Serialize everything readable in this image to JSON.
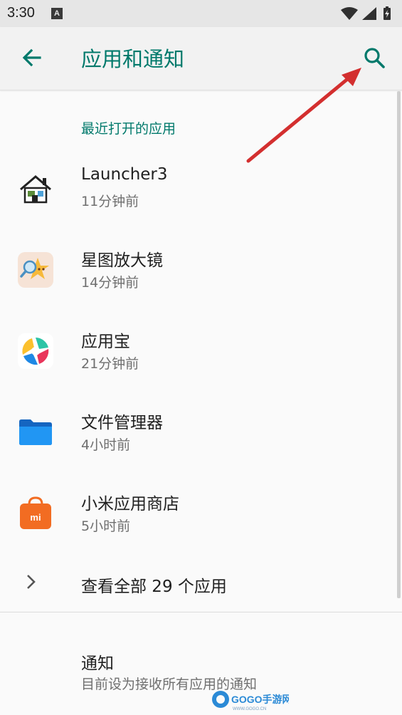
{
  "status_bar": {
    "time": "3:30",
    "notification_letter": "A"
  },
  "app_bar": {
    "title": "应用和通知"
  },
  "recent": {
    "header": "最近打开的应用",
    "apps": [
      {
        "name": "Launcher3",
        "time": "11分钟前",
        "icon": "launcher3-house-icon"
      },
      {
        "name": "星图放大镜",
        "time": "14分钟前",
        "icon": "star-magnifier-icon"
      },
      {
        "name": "应用宝",
        "time": "21分钟前",
        "icon": "yingyongbao-icon"
      },
      {
        "name": "文件管理器",
        "time": "4小时前",
        "icon": "folder-icon"
      },
      {
        "name": "小米应用商店",
        "time": "5小时前",
        "icon": "mi-store-bag-icon"
      }
    ]
  },
  "view_all": {
    "label": "查看全部 29 个应用"
  },
  "notifications": {
    "title": "通知",
    "subtitle": "目前设为接收所有应用的通知"
  },
  "watermark": {
    "text": "GOGO手游网",
    "domain": "WWW.GOGO.CN"
  },
  "colors": {
    "accent": "#00796b",
    "annotation_arrow": "#d32f2f"
  }
}
